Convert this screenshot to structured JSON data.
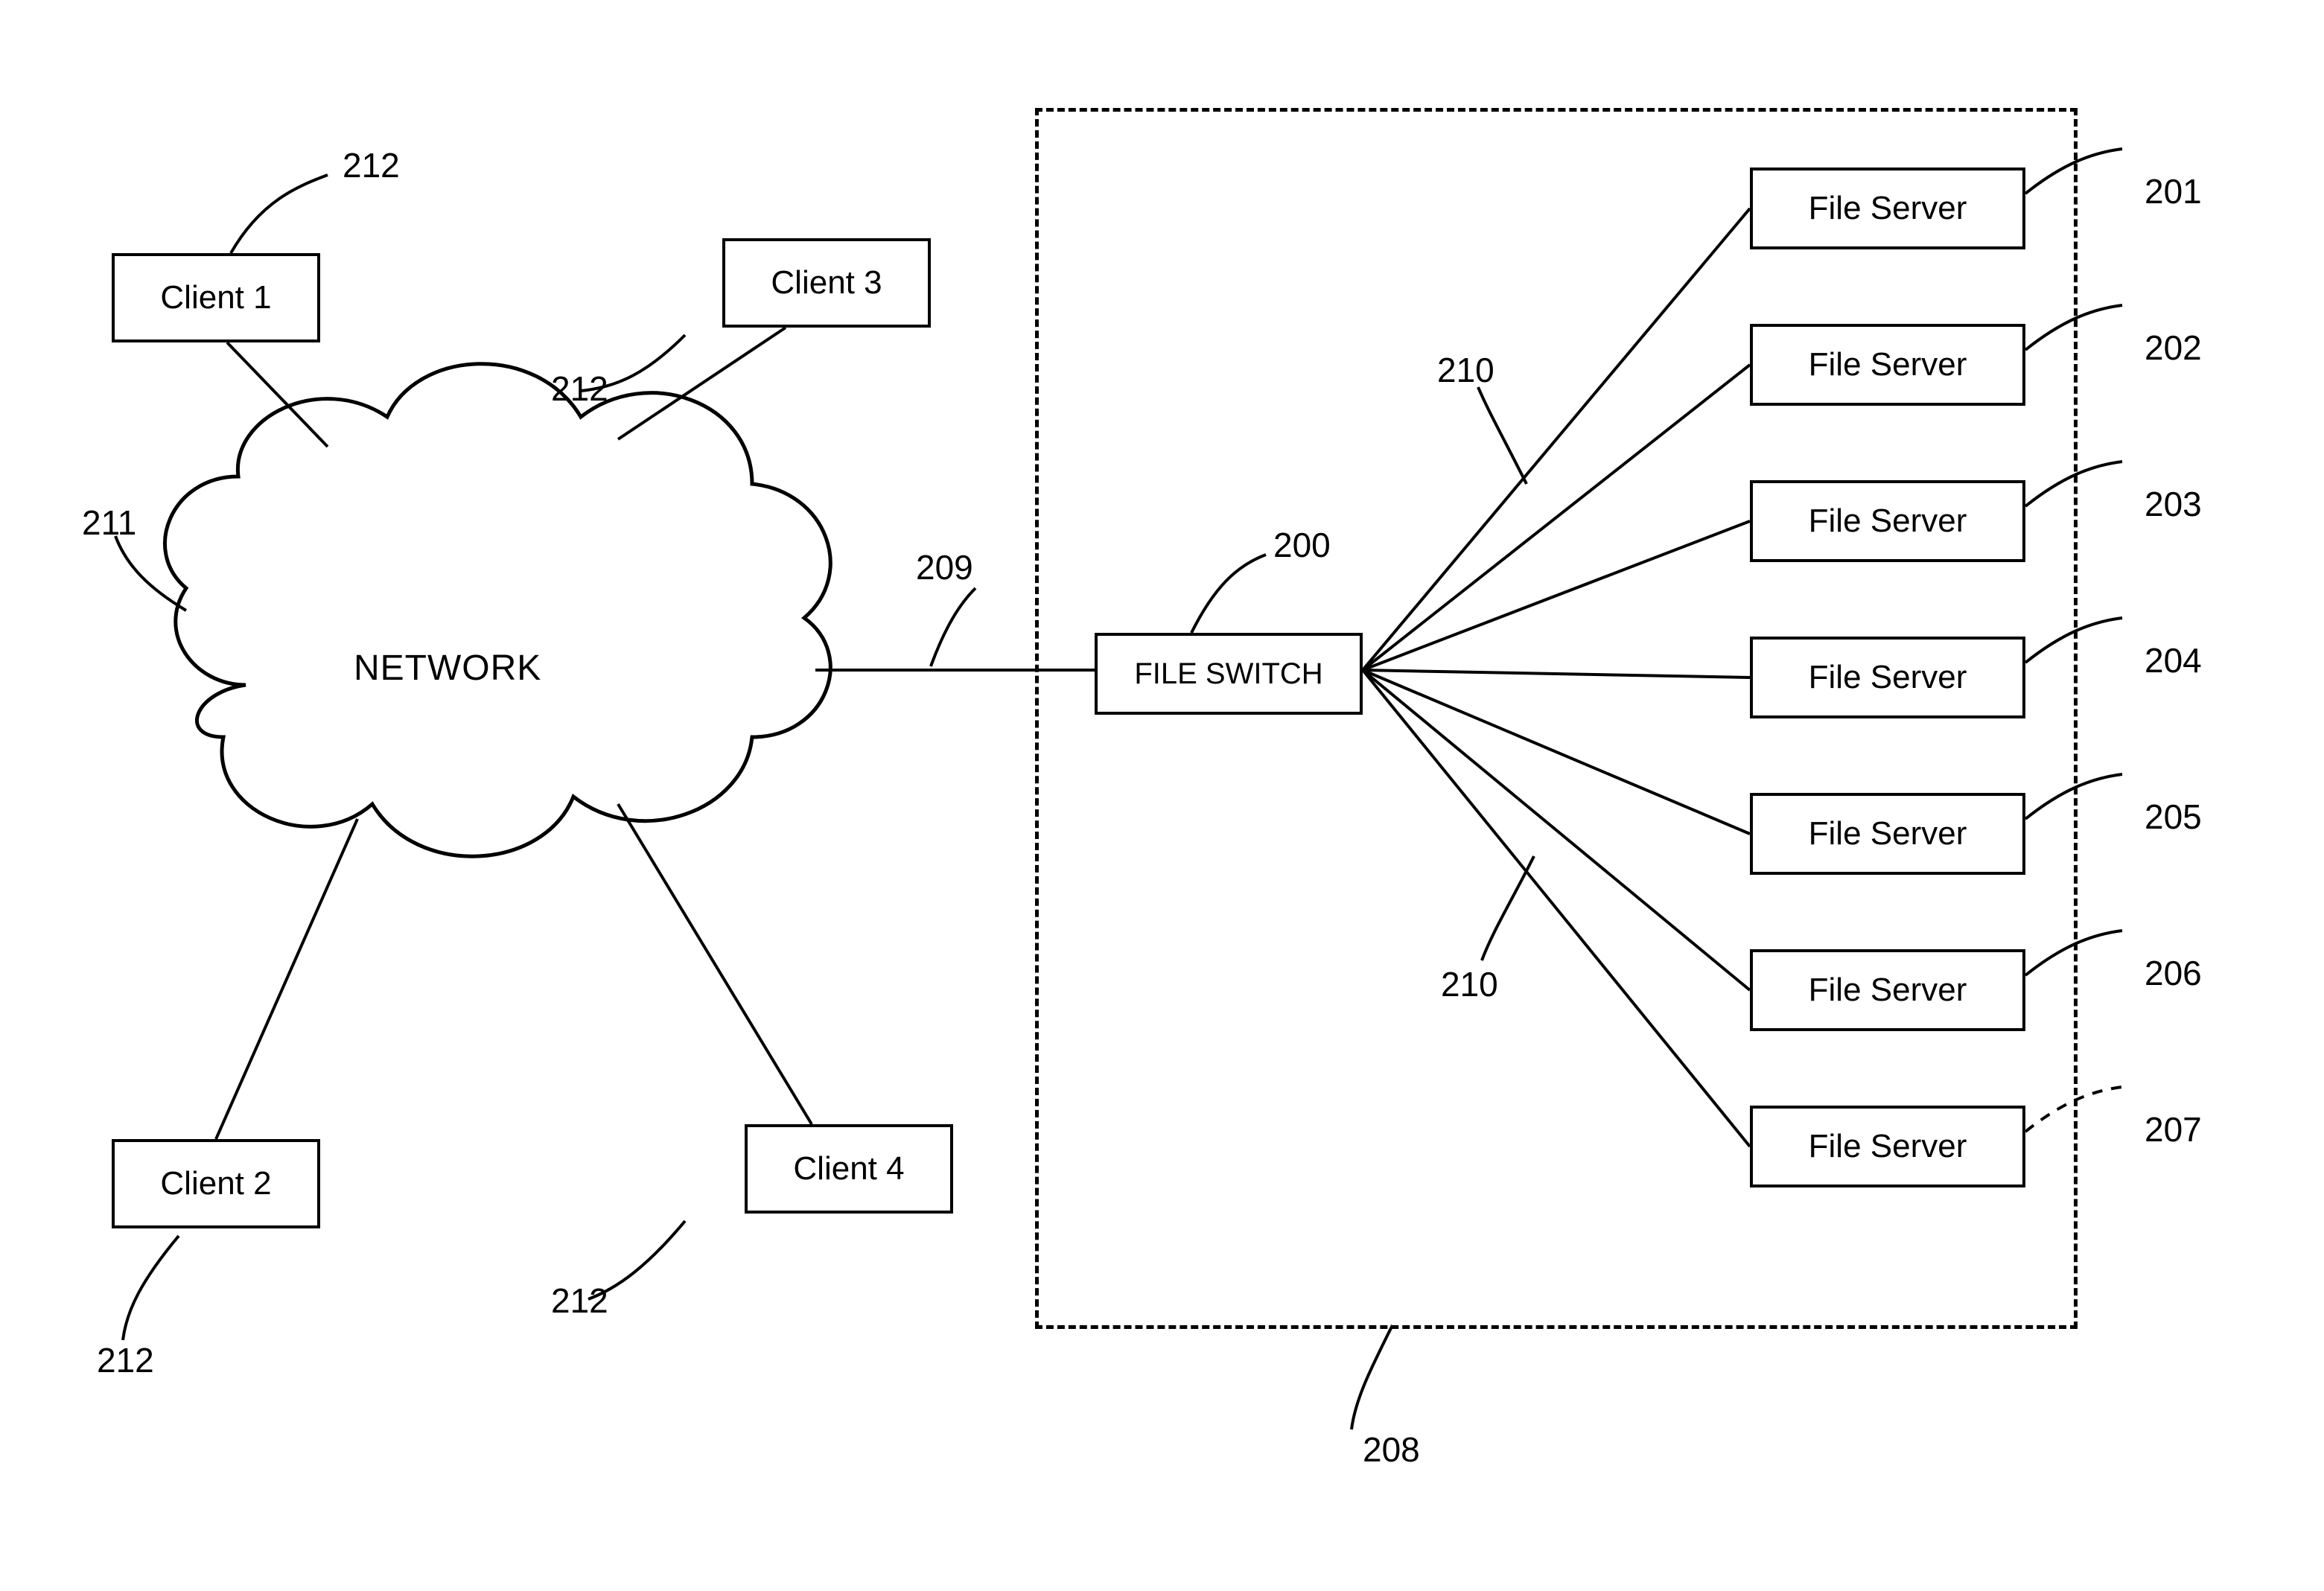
{
  "clients": {
    "c1": {
      "label": "Client 1",
      "ref": "212"
    },
    "c2": {
      "label": "Client 2",
      "ref": "212"
    },
    "c3": {
      "label": "Client 3",
      "ref": "212"
    },
    "c4": {
      "label": "Client 4",
      "ref": "212"
    }
  },
  "network": {
    "label": "NETWORK",
    "ref_left": "211",
    "ref_right": "209"
  },
  "file_switch": {
    "label": "FILE SWITCH",
    "ref": "200"
  },
  "fan_ref_top": "210",
  "fan_ref_bottom": "210",
  "nas_box_ref": "208",
  "servers": [
    {
      "label": "File Server",
      "ref": "201"
    },
    {
      "label": "File Server",
      "ref": "202"
    },
    {
      "label": "File Server",
      "ref": "203"
    },
    {
      "label": "File Server",
      "ref": "204"
    },
    {
      "label": "File Server",
      "ref": "205"
    },
    {
      "label": "File Server",
      "ref": "206"
    },
    {
      "label": "File Server",
      "ref": "207"
    }
  ]
}
